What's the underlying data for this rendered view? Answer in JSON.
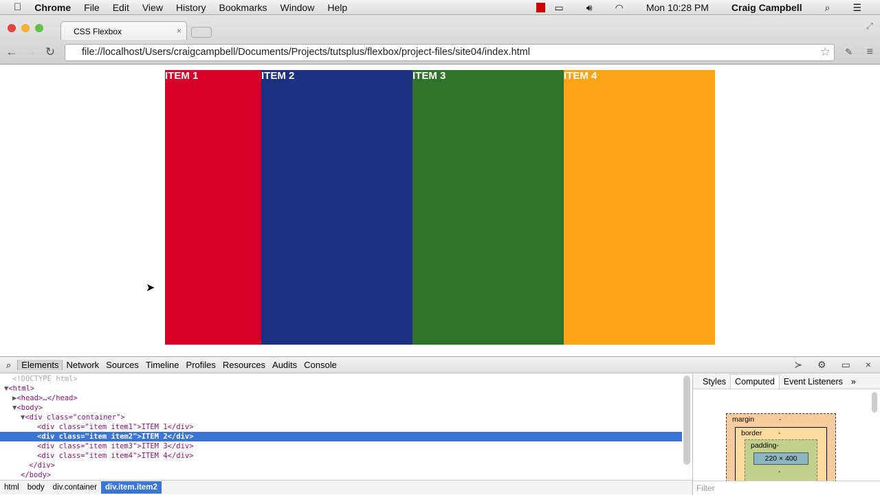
{
  "menubar": {
    "app": "Chrome",
    "items": [
      "File",
      "Edit",
      "View",
      "History",
      "Bookmarks",
      "Window",
      "Help"
    ],
    "clock": "Mon 10:28 PM",
    "user": "Craig Campbell"
  },
  "browser": {
    "tab_title": "CSS Flexbox",
    "url": "file://localhost/Users/craigcampbell/Documents/Projects/tutsplus/flexbox/project-files/site04/index.html"
  },
  "page": {
    "items": [
      {
        "label": "ITEM 1",
        "color": "#d50029"
      },
      {
        "label": "ITEM 2",
        "color": "#1c2f80"
      },
      {
        "label": "ITEM 3",
        "color": "#2f732b"
      },
      {
        "label": "ITEM 4",
        "color": "#fda419"
      }
    ]
  },
  "devtools": {
    "tabs": [
      "Elements",
      "Network",
      "Sources",
      "Timeline",
      "Profiles",
      "Resources",
      "Audits",
      "Console"
    ],
    "breadcrumbs": [
      "html",
      "body",
      "div.container",
      "div.item.item2"
    ],
    "sidebar_tabs": [
      "Styles",
      "Computed",
      "Event Listeners",
      "»"
    ],
    "box_model": {
      "margin": "margin",
      "border": "border",
      "padding": "padding",
      "dash": "-",
      "content": "220 × 400"
    },
    "filter_placeholder": "Filter",
    "tree": {
      "doctype": "<!DOCTYPE html>",
      "html": "<html>",
      "head": "<head>…</head>",
      "body": "<body>",
      "container_open": "<div class=\"container\">",
      "rows": [
        "<div class=\"item item1\">ITEM 1</div>",
        "<div class=\"item item2\">ITEM 2</div>",
        "<div class=\"item item3\">ITEM 3</div>",
        "<div class=\"item item4\">ITEM 4</div>"
      ],
      "container_close": "</div>",
      "body_close": "</body>"
    }
  }
}
